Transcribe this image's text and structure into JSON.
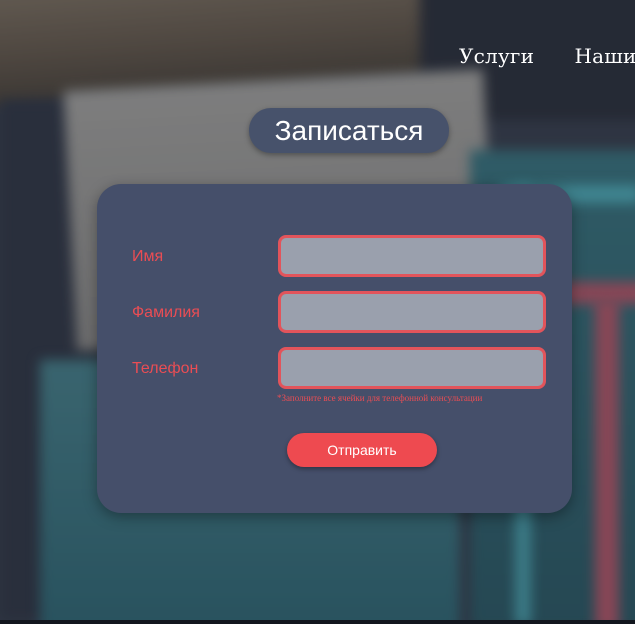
{
  "nav": {
    "items": [
      {
        "label": "Услуги"
      },
      {
        "label": "Наши ра"
      }
    ]
  },
  "form": {
    "title": "Записаться",
    "fields": [
      {
        "label": "Имя",
        "value": "",
        "placeholder": ""
      },
      {
        "label": "Фамилия",
        "value": "",
        "placeholder": ""
      },
      {
        "label": "Телефон",
        "value": "",
        "placeholder": ""
      }
    ],
    "hint": "*Заполните все ячейки для телефонной консультации",
    "submit_label": "Отправить"
  },
  "colors": {
    "accent": "#ee4a50",
    "card": "#454f6a",
    "input_bg": "#9aa0ad",
    "label": "#ea4d54"
  }
}
